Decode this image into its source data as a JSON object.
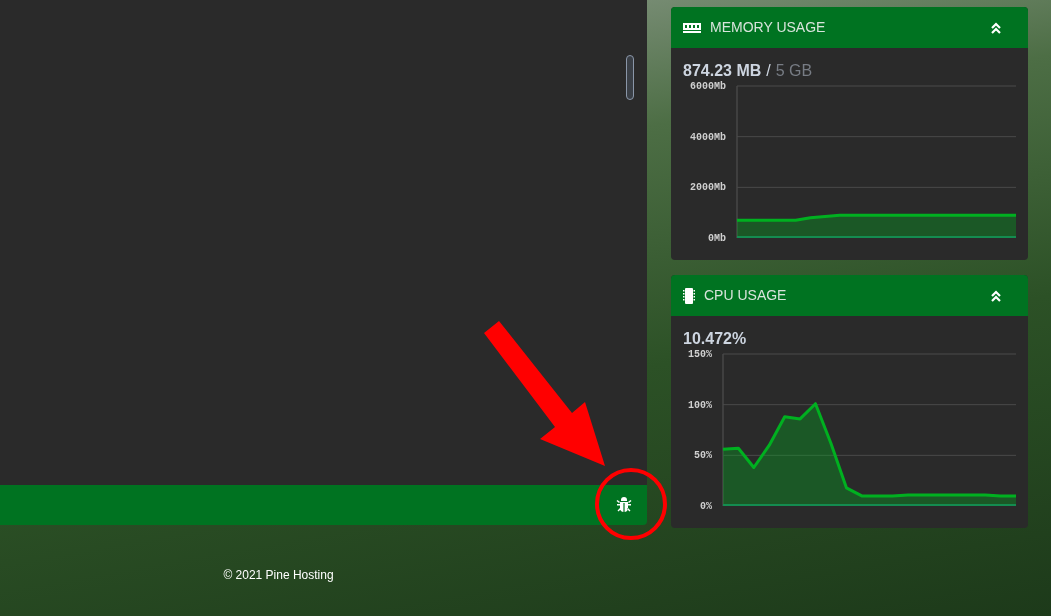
{
  "footer": {
    "copyright": "© 2021 Pine Hosting"
  },
  "cards": [
    {
      "kind": "memory",
      "title": "MEMORY USAGE",
      "used": "874.23 MB",
      "separator": "/",
      "total": "5 GB",
      "chart_data": {
        "type": "area",
        "ylim": [
          0,
          6000
        ],
        "yticks": [
          {
            "value": 0,
            "label": "0Mb"
          },
          {
            "value": 2000,
            "label": "2000Mb"
          },
          {
            "value": 4000,
            "label": "4000Mb"
          },
          {
            "value": 6000,
            "label": "6000Mb"
          }
        ],
        "series": [
          {
            "color": "#00b020",
            "values": [
              700,
              700,
              700,
              700,
              700,
              800,
              850,
              900,
              900,
              900,
              900,
              900,
              900,
              900,
              900,
              900,
              900,
              900,
              900,
              900
            ]
          }
        ]
      }
    },
    {
      "kind": "cpu",
      "title": "CPU USAGE",
      "used": "10.472%",
      "chart_data": {
        "type": "area",
        "ylim": [
          0,
          150
        ],
        "yticks": [
          {
            "value": 0,
            "label": "0%"
          },
          {
            "value": 50,
            "label": "50%"
          },
          {
            "value": 100,
            "label": "100%"
          },
          {
            "value": 150,
            "label": "150%"
          }
        ],
        "series": [
          {
            "color": "#00b020",
            "values": [
              56,
              57,
              38,
              60,
              88,
              86,
              101,
              62,
              18,
              10,
              10,
              10,
              11,
              11,
              11,
              11,
              11,
              11,
              10,
              10
            ]
          }
        ]
      }
    }
  ]
}
